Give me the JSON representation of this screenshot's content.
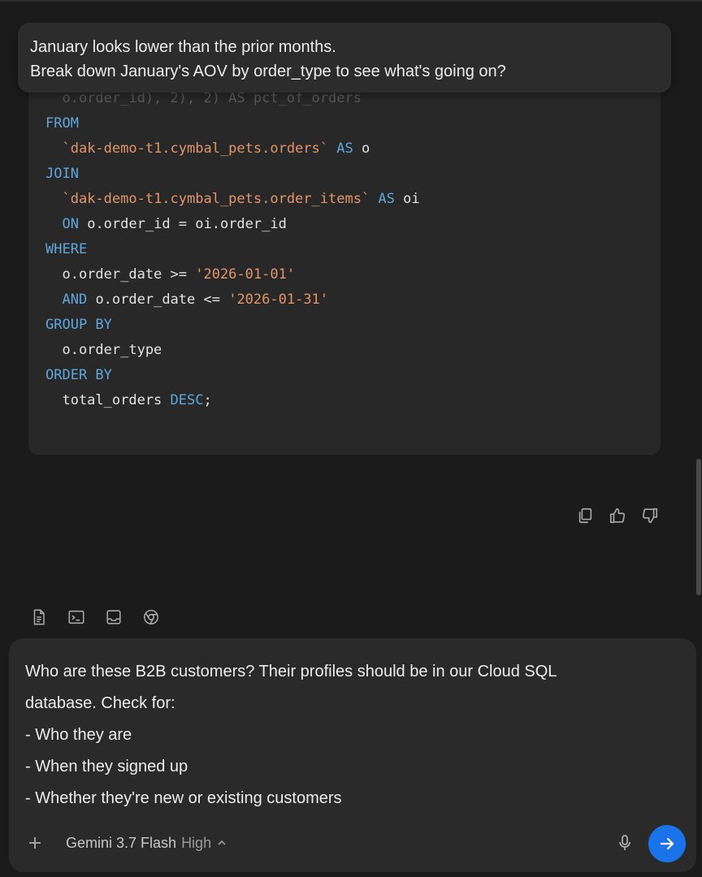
{
  "user_message": {
    "line1": "January looks lower than the prior months.",
    "line2": "Break down January's AOV by order_type to see what's going on?"
  },
  "code_block": {
    "lines": [
      {
        "parts": [
          {
            "t": "  o.order_id), 2), 2) AS pct_of_orders",
            "c": "faded"
          }
        ]
      },
      {
        "parts": [
          {
            "t": "FROM",
            "c": "kw"
          }
        ]
      },
      {
        "parts": [
          {
            "t": "  ",
            "c": ""
          },
          {
            "t": "`dak-demo-t1.cymbal_pets.orders`",
            "c": "str"
          },
          {
            "t": " AS",
            "c": "kw"
          },
          {
            "t": " o",
            "c": ""
          }
        ]
      },
      {
        "parts": [
          {
            "t": "JOIN",
            "c": "kw"
          }
        ]
      },
      {
        "parts": [
          {
            "t": "  ",
            "c": ""
          },
          {
            "t": "`dak-demo-t1.cymbal_pets.order_items`",
            "c": "str"
          },
          {
            "t": " AS",
            "c": "kw"
          },
          {
            "t": " oi",
            "c": ""
          }
        ]
      },
      {
        "parts": [
          {
            "t": "  ",
            "c": ""
          },
          {
            "t": "ON",
            "c": "kw"
          },
          {
            "t": " o.order_id = oi.order_id",
            "c": ""
          }
        ]
      },
      {
        "parts": [
          {
            "t": "WHERE",
            "c": "kw"
          }
        ]
      },
      {
        "parts": [
          {
            "t": "  o.order_date >= ",
            "c": ""
          },
          {
            "t": "'2026-01-01'",
            "c": "str"
          }
        ]
      },
      {
        "parts": [
          {
            "t": "  ",
            "c": ""
          },
          {
            "t": "AND",
            "c": "kw"
          },
          {
            "t": " o.order_date <= ",
            "c": ""
          },
          {
            "t": "'2026-01-31'",
            "c": "str"
          }
        ]
      },
      {
        "parts": [
          {
            "t": "GROUP BY",
            "c": "kw"
          }
        ]
      },
      {
        "parts": [
          {
            "t": "  o.order_type",
            "c": ""
          }
        ]
      },
      {
        "parts": [
          {
            "t": "ORDER BY",
            "c": "kw"
          }
        ]
      },
      {
        "parts": [
          {
            "t": "  total_orders ",
            "c": ""
          },
          {
            "t": "DESC",
            "c": "kw"
          },
          {
            "t": ";",
            "c": ""
          }
        ]
      }
    ]
  },
  "actions": {
    "copy_icon": "copy-icon",
    "thumbs_up_icon": "thumbs-up-icon",
    "thumbs_down_icon": "thumbs-down-icon"
  },
  "context_buttons": [
    "file-icon",
    "terminal-icon",
    "inbox-icon",
    "chrome-icon"
  ],
  "input": {
    "lines": [
      "Who are these B2B customers? Their profiles should be in our Cloud SQL",
      "database. Check for:",
      "- Who they are",
      "- When they signed up",
      "- Whether they're new or existing customers"
    ],
    "model_name": "Gemini 3.7 Flash",
    "model_variant": "High"
  },
  "colors": {
    "accent": "#1a73e8",
    "keyword": "#5ea6dc",
    "string": "#e2956a"
  }
}
